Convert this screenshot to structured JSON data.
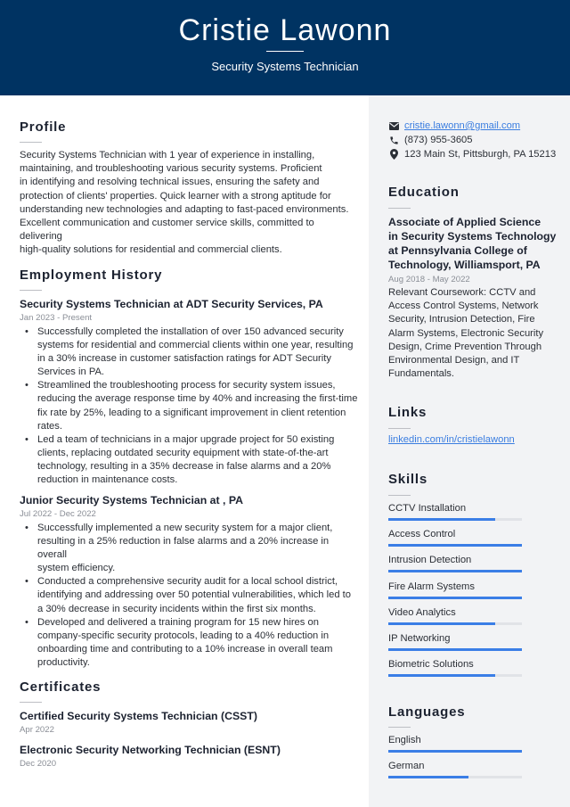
{
  "header": {
    "name": "Cristie Lawonn",
    "title": "Security Systems Technician"
  },
  "colors": {
    "header_bg": "#003362",
    "sidebar_bg": "#f2f3f5",
    "accent": "#3b7ee6",
    "link": "#3a7de0"
  },
  "profile": {
    "heading": "Profile",
    "lines": [
      "Security Systems Technician with 1 year of experience in installing,",
      "maintaining, and troubleshooting various security systems. Proficient",
      "in identifying and resolving technical issues, ensuring the safety and",
      "protection of clients' properties. Quick learner with a strong aptitude for",
      "understanding new technologies and adapting to fast-paced environments.",
      "Excellent communication and customer service skills, committed to delivering",
      "high-quality solutions for residential and commercial clients."
    ]
  },
  "employment": {
    "heading": "Employment History",
    "jobs": [
      {
        "title": "Security Systems Technician at ADT Security Services, PA",
        "dates": "Jan 2023 - Present",
        "bullets": [
          [
            "Successfully completed the installation of over 150 advanced security",
            "systems for residential and commercial clients within one year, resulting",
            "in a 30% increase in customer satisfaction ratings for ADT Security",
            "Services in PA."
          ],
          [
            "Streamlined the troubleshooting process for security system issues,",
            "reducing the average response time by 40% and increasing the first-time",
            "fix rate by 25%, leading to a significant improvement in client retention",
            "rates."
          ],
          [
            "Led a team of technicians in a major upgrade project for 50 existing",
            "clients, replacing outdated security equipment with state-of-the-art",
            "technology, resulting in a 35% decrease in false alarms and a 20%",
            "reduction in maintenance costs."
          ]
        ]
      },
      {
        "title": "Junior Security Systems Technician at , PA",
        "dates": "Jul 2022 - Dec 2022",
        "bullets": [
          [
            "Successfully implemented a new security system for a major client,",
            "resulting in a 25% reduction in false alarms and a 20% increase in overall",
            "system efficiency."
          ],
          [
            "Conducted a comprehensive security audit for a local school district,",
            "identifying and addressing over 50 potential vulnerabilities, which led to",
            "a 30% decrease in security incidents within the first six months."
          ],
          [
            "Developed and delivered a training program for 15 new hires on",
            "company-specific security protocols, leading to a 40% reduction in",
            "onboarding time and contributing to a 10% increase in overall team",
            "productivity."
          ]
        ]
      }
    ]
  },
  "certificates": {
    "heading": "Certificates",
    "items": [
      {
        "name": "Certified Security Systems Technician (CSST)",
        "date": "Apr 2022"
      },
      {
        "name": "Electronic Security Networking Technician (ESNT)",
        "date": "Dec 2020"
      }
    ]
  },
  "contact": {
    "email": "cristie.lawonn@gmail.com",
    "phone": "(873) 955-3605",
    "address": "123 Main St, Pittsburgh, PA 15213",
    "email_icon": "envelope-icon",
    "phone_icon": "phone-icon",
    "address_icon": "map-pin-icon"
  },
  "education": {
    "heading": "Education",
    "degree_lines": [
      "Associate of Applied Science",
      "in Security Systems Technology",
      "at Pennsylvania College of",
      "Technology, Williamsport, PA"
    ],
    "dates": "Aug 2018 - May 2022",
    "coursework_lines": [
      "Relevant Coursework: CCTV and",
      "Access Control Systems, Network",
      "Security, Intrusion Detection, Fire",
      "Alarm Systems, Electronic Security",
      "Design, Crime Prevention Through",
      "Environmental Design, and IT",
      "Fundamentals."
    ]
  },
  "links": {
    "heading": "Links",
    "items": [
      {
        "label": "linkedin.com/in/cristielawonn"
      }
    ]
  },
  "skills": {
    "heading": "Skills",
    "items": [
      {
        "name": "CCTV Installation",
        "level": 0.8
      },
      {
        "name": "Access Control",
        "level": 1.0
      },
      {
        "name": "Intrusion Detection",
        "level": 1.0
      },
      {
        "name": "Fire Alarm Systems",
        "level": 1.0
      },
      {
        "name": "Video Analytics",
        "level": 0.8
      },
      {
        "name": "IP Networking",
        "level": 1.0
      },
      {
        "name": "Biometric Solutions",
        "level": 0.8
      }
    ]
  },
  "languages": {
    "heading": "Languages",
    "items": [
      {
        "name": "English",
        "level": 1.0
      },
      {
        "name": "German",
        "level": 0.6
      }
    ]
  }
}
